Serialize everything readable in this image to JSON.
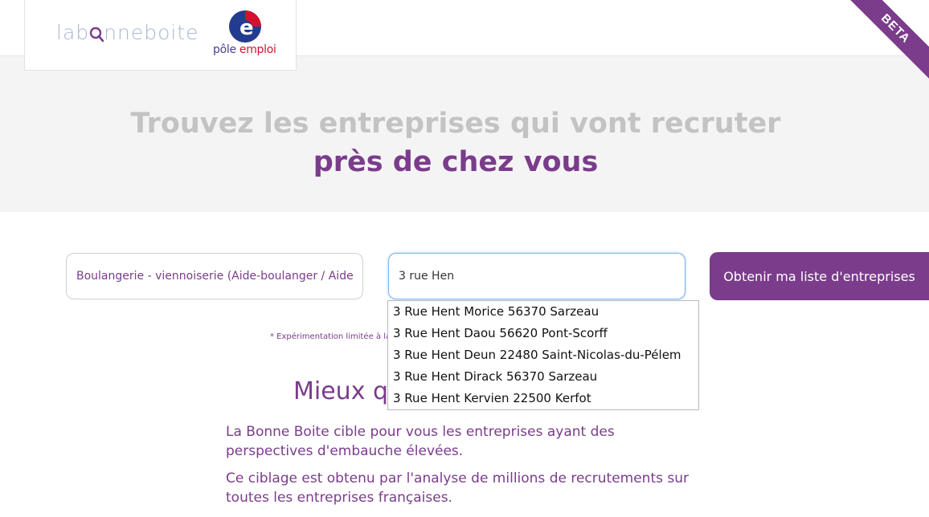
{
  "header": {
    "logo_text_left": "lab",
    "logo_text_right": "nneboite",
    "partner_logo_text_a": "pôle ",
    "partner_logo_text_b": "emploi",
    "beta_label": "BETA"
  },
  "hero": {
    "line1": "Trouvez les entreprises qui vont recruter",
    "line2": "près de chez vous"
  },
  "search": {
    "job_value": "Boulangerie - viennoiserie (Aide-boulanger / Aide-bou",
    "location_value": "3 rue Hen",
    "submit_label": "Obtenir ma liste d'entreprises"
  },
  "footnote": "* Expérimentation limitée à la F",
  "autocomplete": {
    "items": [
      "3 Rue Hent Morice 56370 Sarzeau",
      "3 Rue Hent Daou 56620 Pont-Scorff",
      "3 Rue Hent Deun 22480 Saint-Nicolas-du-Pélem",
      "3 Rue Hent Dirack 56370 Sarzeau",
      "3 Rue Hent Kervien 22500 Kerfot"
    ]
  },
  "section": {
    "title": "Mieux qu",
    "paragraph1": "La Bonne Boite cible pour vous les entreprises ayant des perspectives d'embauche élevées.",
    "paragraph2": "Ce ciblage est obtenu par l'analyse de millions de recrutements sur toutes les entreprises françaises."
  },
  "colors": {
    "brand": "#7a3c8b",
    "hero_bg": "#f4f4f4",
    "focus_border": "#7eb3ee"
  }
}
